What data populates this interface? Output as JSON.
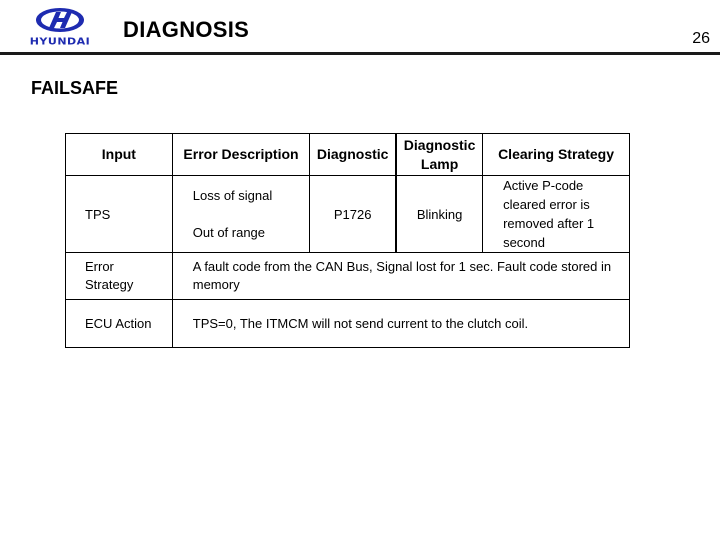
{
  "header": {
    "logo_text": "HYUNDAI",
    "logo_color": "#1e2bb0",
    "title": "DIAGNOSIS",
    "page_number": "26"
  },
  "section_title": "FAILSAFE",
  "table": {
    "columns": [
      "Input",
      "Error Description",
      "Diagnostic",
      "Diagnostic Lamp",
      "Clearing Strategy"
    ],
    "rows": [
      {
        "input": "TPS",
        "error_description": [
          "Loss of signal",
          "Out of range"
        ],
        "diagnostic": "P1726",
        "diagnostic_lamp": "Blinking",
        "clearing_strategy": "Active P-code cleared error is removed after 1 second"
      }
    ],
    "error_strategy": {
      "label": "Error Strategy",
      "text": "A fault code from the CAN Bus, Signal lost for 1 sec. Fault code stored in memory"
    },
    "ecu_action": {
      "label": "ECU Action",
      "text": "TPS=0, The ITMCM will not send current to the clutch coil."
    }
  }
}
